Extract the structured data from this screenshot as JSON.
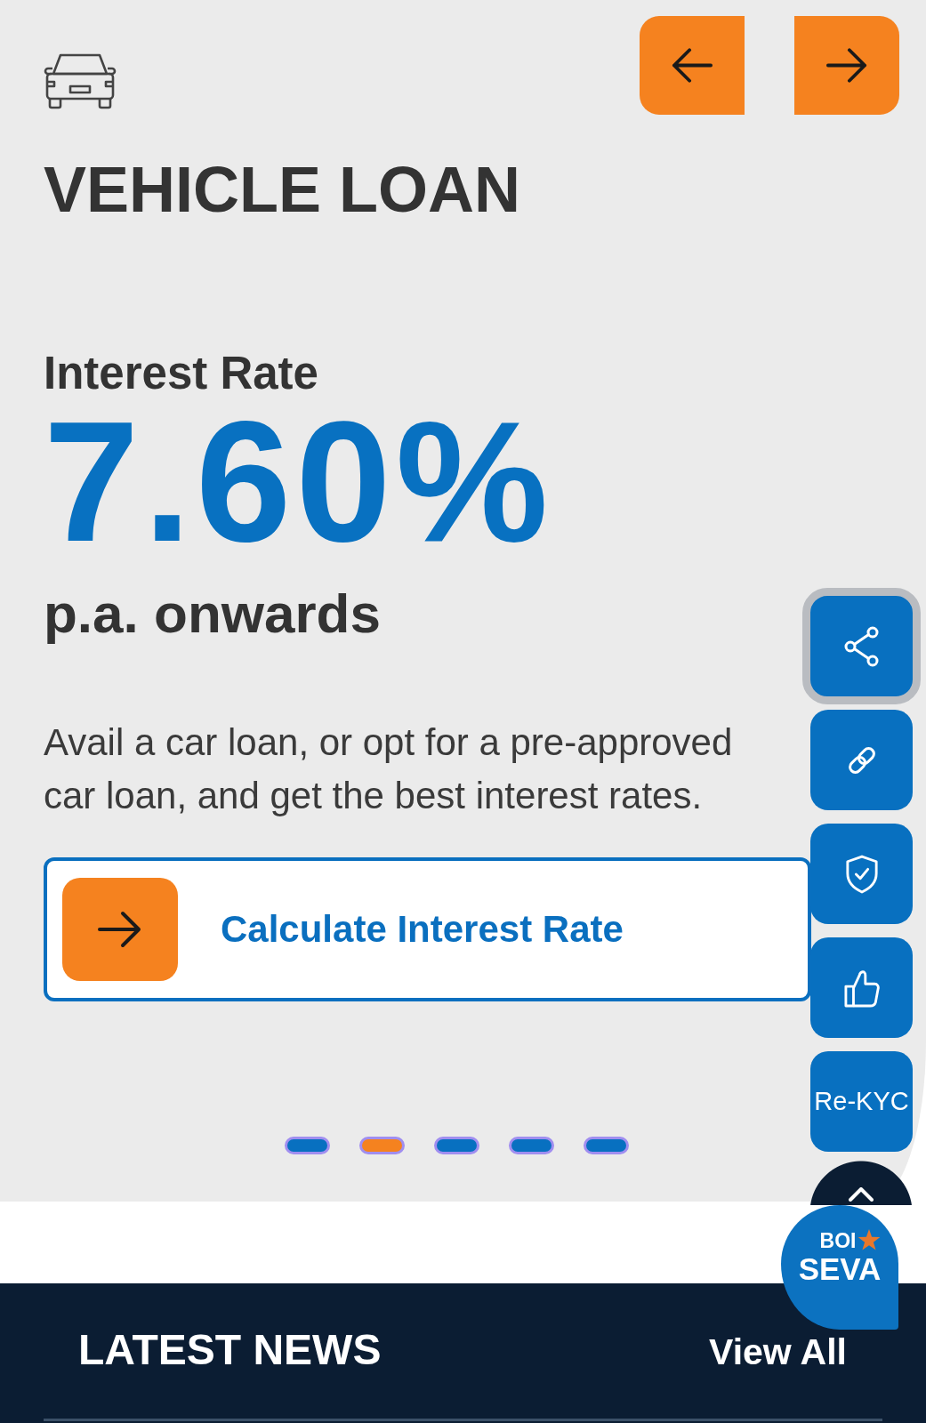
{
  "hero": {
    "nav_buttons": [
      {
        "kind": "previous"
      },
      {
        "kind": "next"
      }
    ],
    "title": "VEHICLE LOAN",
    "rate_label": "Interest Rate",
    "rate": "7.60%",
    "rate_suffix": "p.a. onwards",
    "description": "Avail a car loan, or opt for a pre-approved car loan, and get the best interest rates.",
    "cta": {
      "label": "Calculate Interest Rate"
    },
    "slides": [
      {
        "selected": false
      },
      {
        "selected": true
      },
      {
        "selected": false
      },
      {
        "selected": false
      },
      {
        "selected": false
      }
    ]
  },
  "side_actions": [
    {
      "kind": "share",
      "focused": true
    },
    {
      "kind": "link",
      "focused": false
    },
    {
      "kind": "shield",
      "focused": false
    },
    {
      "kind": "like",
      "focused": false
    },
    {
      "kind": "text",
      "label": "Re-KYC",
      "focused": false
    }
  ],
  "chat_badge": {
    "line_1": "BOI",
    "line_2": "SEVA"
  },
  "news": {
    "title": "LATEST NEWS",
    "link": "View All"
  }
}
